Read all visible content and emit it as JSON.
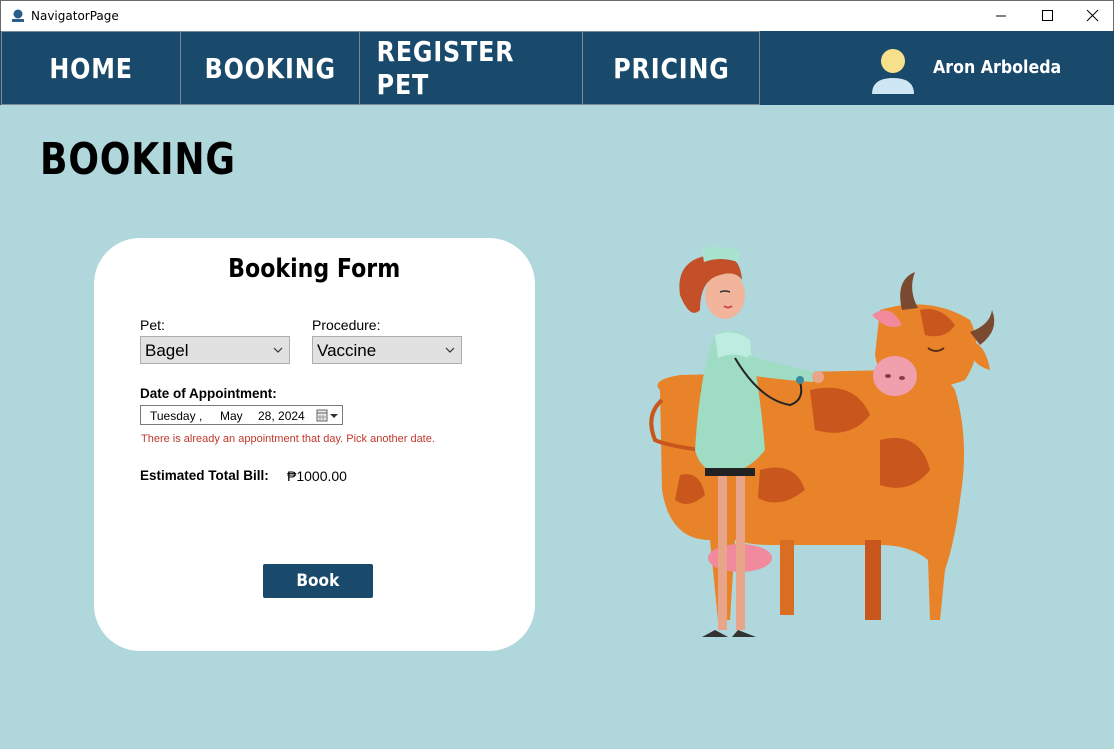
{
  "window": {
    "title": "NavigatorPage",
    "controls": [
      "minimize",
      "maximize",
      "close"
    ]
  },
  "nav": {
    "items": [
      {
        "label": "HOME"
      },
      {
        "label": "BOOKING"
      },
      {
        "label": "REGISTER PET"
      },
      {
        "label": "PRICING"
      }
    ],
    "user": {
      "name": "Aron Arboleda",
      "icon": "user-avatar-icon"
    }
  },
  "page": {
    "title": "BOOKING"
  },
  "form": {
    "title": "Booking Form",
    "pet_label": "Pet:",
    "pet_value": "Bagel",
    "procedure_label": "Procedure:",
    "procedure_value": "Vaccine",
    "date_label": "Date of Appointment:",
    "date": {
      "weekday": "Tuesday",
      "separator": ",",
      "month": "May",
      "day_year": "28, 2024"
    },
    "error": "There is already an appointment that day. Pick another date.",
    "total_label": "Estimated Total Bill:",
    "total_value": "₱1000.00",
    "book_label": "Book"
  },
  "colors": {
    "navbar": "#1a4a6b",
    "background": "#b0d7db",
    "card": "#ffffff",
    "button": "#1a4a6b",
    "error": "#c0392b"
  }
}
